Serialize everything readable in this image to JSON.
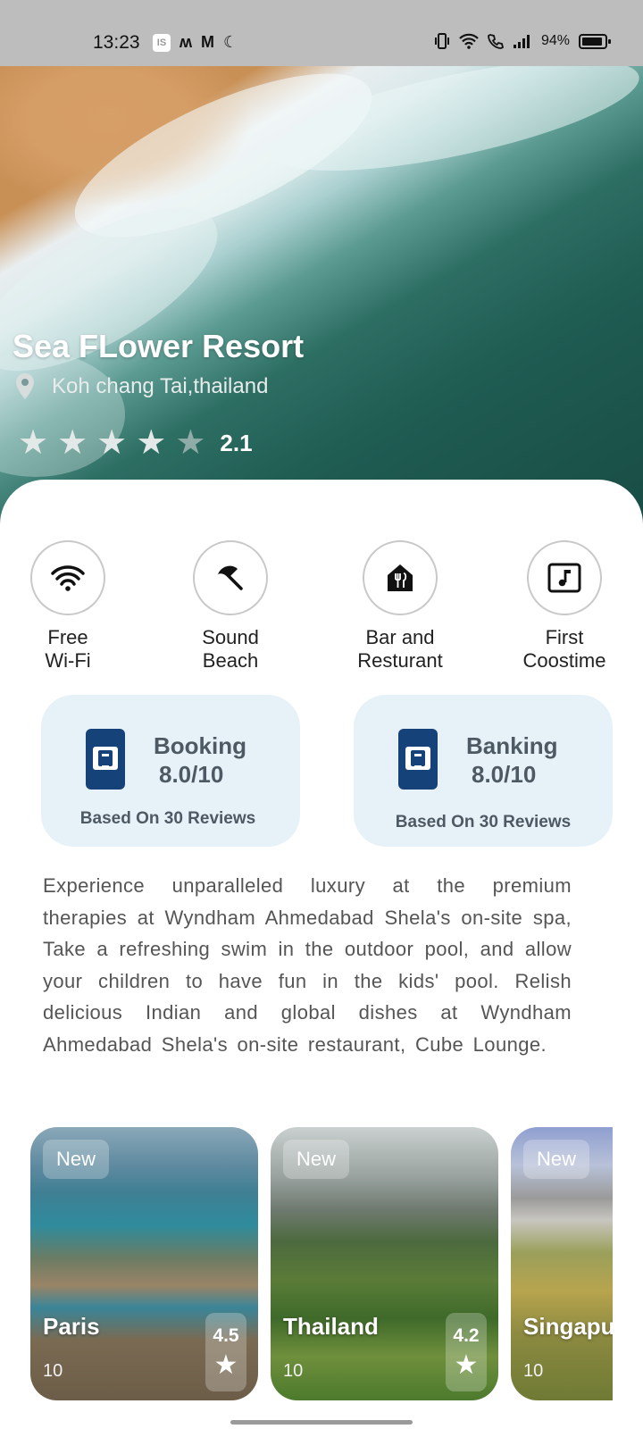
{
  "status_bar": {
    "time": "13:23",
    "badge": "IS",
    "battery": "94%"
  },
  "hero": {
    "title": "Sea FLower Resort",
    "location": "Koh chang Tai,thailand",
    "rating": "2.1",
    "stars_filled": 4,
    "stars_total": 5
  },
  "amenities": [
    {
      "label": "Free\n Wi-Fi",
      "icon": "wifi-icon"
    },
    {
      "label": "Sound\n Beach",
      "icon": "beach-umbrella-icon"
    },
    {
      "label": "Bar and\nResturant",
      "icon": "restaurant-icon"
    },
    {
      "label": "First\nCoostime",
      "icon": "music-note-icon"
    }
  ],
  "reviews": [
    {
      "title": "Booking",
      "score": "8.0/10",
      "note": "Based On 30 Reviews"
    },
    {
      "title": "Banking",
      "score": "8.0/10",
      "note": "Based On 30 Reviews"
    }
  ],
  "description": "Experience unparalleled luxury at the premium therapies at Wyndham Ahmedabad Shela's on-site spa, Take a refreshing swim in the outdoor pool, and allow your children to have fun in the kids' pool. Relish delicious Indian and global dishes at Wyndham Ahmedabad Shela's on-site restaurant, Cube Lounge.",
  "destinations": [
    {
      "badge": "New",
      "name": "Paris",
      "count": "10",
      "rating": "4.5"
    },
    {
      "badge": "New",
      "name": "Thailand",
      "count": "10",
      "rating": "4.2"
    },
    {
      "badge": "New",
      "name": "Singapu",
      "count": "10",
      "rating": ""
    }
  ],
  "colors": {
    "accent": "#16427a",
    "card_bg": "#e6f2f7",
    "status_bar": "#bdbdbd"
  }
}
